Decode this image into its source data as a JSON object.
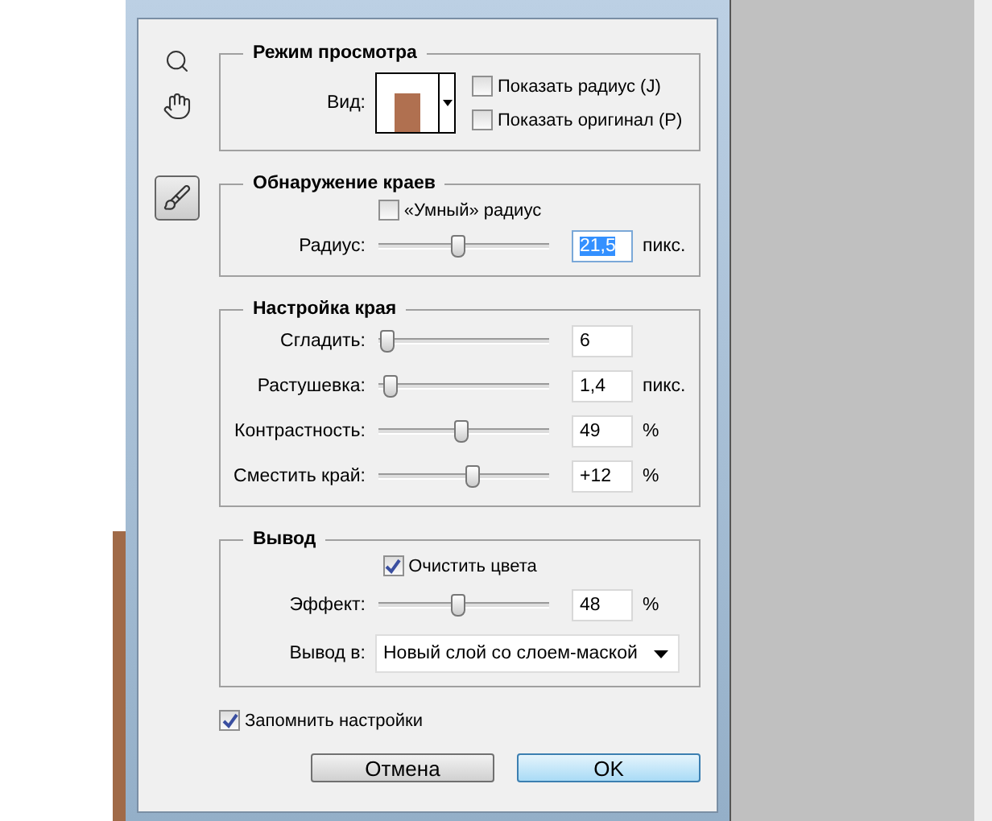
{
  "tools": [
    {
      "kind": "zoom",
      "selected": false
    },
    {
      "kind": "hand",
      "selected": false
    },
    {
      "kind": "brush",
      "selected": true
    }
  ],
  "view_mode": {
    "title": "Режим просмотра",
    "view_label": "Вид:",
    "options": [
      {
        "label": "Показать радиус (J)",
        "checked": false
      },
      {
        "label": "Показать оригинал (P)",
        "checked": false
      }
    ]
  },
  "edge_detection": {
    "title": "Обнаружение краев",
    "smart_radius": {
      "label": "«Умный» радиус",
      "checked": false
    },
    "radius": {
      "label": "Радиус:",
      "level": 0.47,
      "value": "21,5",
      "unit": "пикс.",
      "highlighted": true
    }
  },
  "adjust_edge": {
    "title": "Настройка края",
    "sliders": [
      {
        "label": "Сгладить:",
        "level": 0.06,
        "value": "6"
      },
      {
        "label": "Растушевка:",
        "level": 0.08,
        "value": "1,4",
        "unit": "пикс."
      },
      {
        "label": "Контрастность:",
        "level": 0.49,
        "value": "49",
        "unit": "%"
      },
      {
        "label": "Сместить край:",
        "level": 0.56,
        "value": "+12",
        "unit": "%"
      }
    ]
  },
  "output": {
    "title": "Вывод",
    "decontaminate": {
      "label": "Очистить цвета",
      "checked": true
    },
    "effect": {
      "label": "Эффект:",
      "level": 0.47,
      "value": "48",
      "unit": "%"
    },
    "output_to": {
      "label": "Вывод в:",
      "value": "Новый слой со слоем-маской"
    }
  },
  "remember": {
    "label": "Запомнить настройки",
    "checked": true
  },
  "buttons": [
    {
      "label": "Отмена",
      "default": false
    },
    {
      "label": "OK",
      "default": true
    }
  ]
}
